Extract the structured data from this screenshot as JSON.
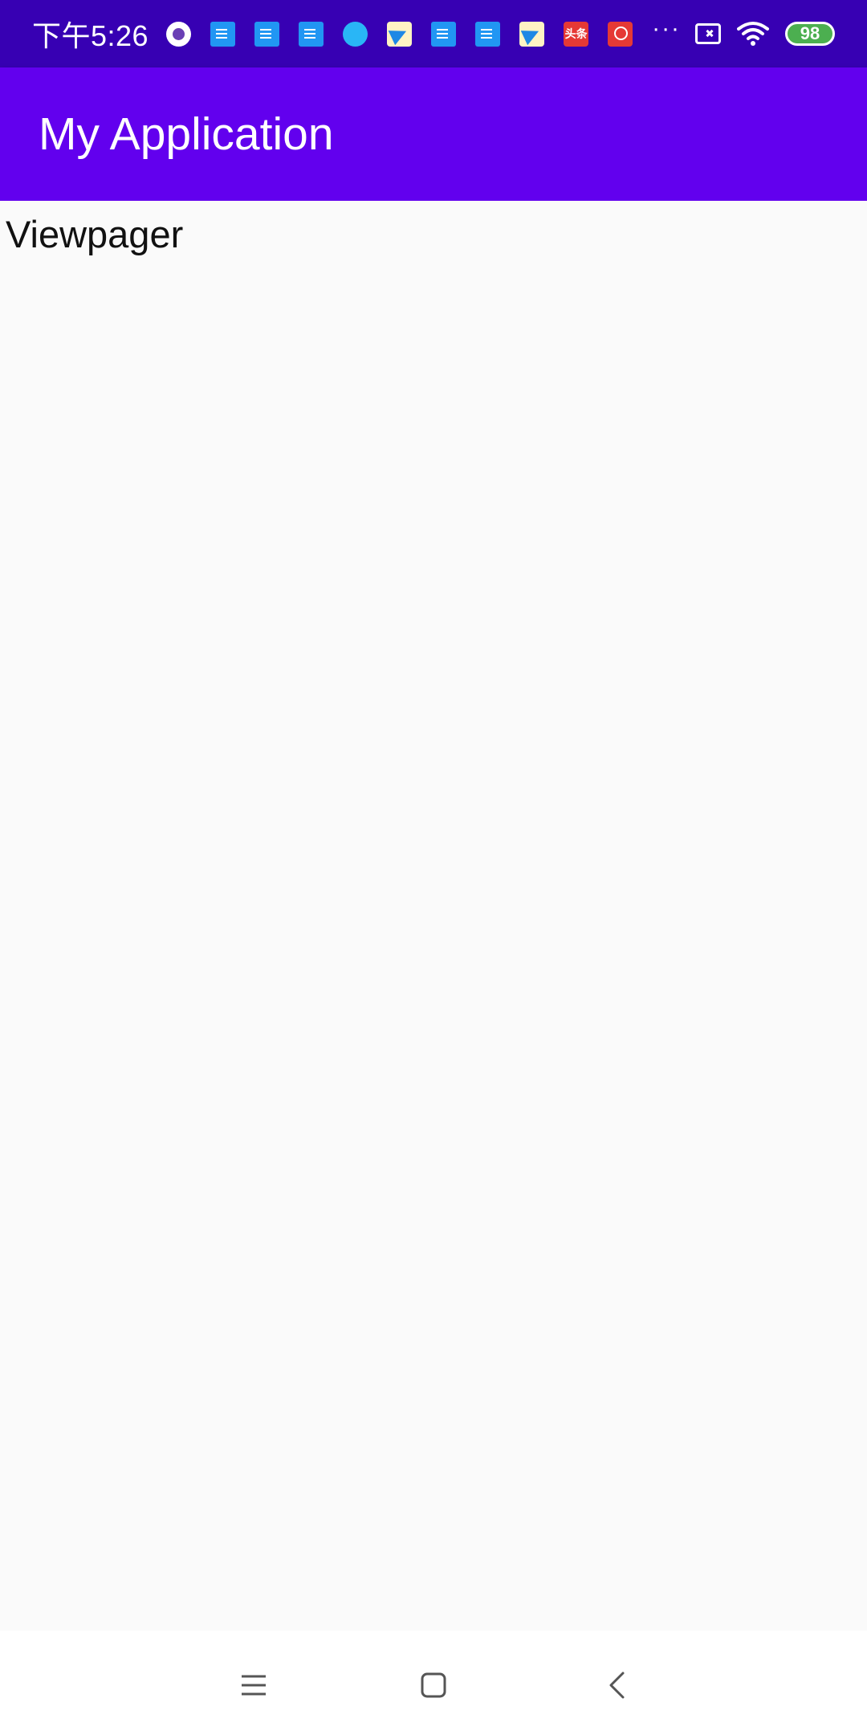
{
  "status_bar": {
    "time": "下午5:26",
    "news_icon_text": "头条",
    "battery_level": "98",
    "more_glyph": "···"
  },
  "app_bar": {
    "title": "My Application",
    "color": "#6200ee"
  },
  "content": {
    "label": "Viewpager"
  },
  "nav_bar": {
    "menu_icon": "menu-icon",
    "home_icon": "home-icon",
    "back_icon": "back-icon"
  }
}
